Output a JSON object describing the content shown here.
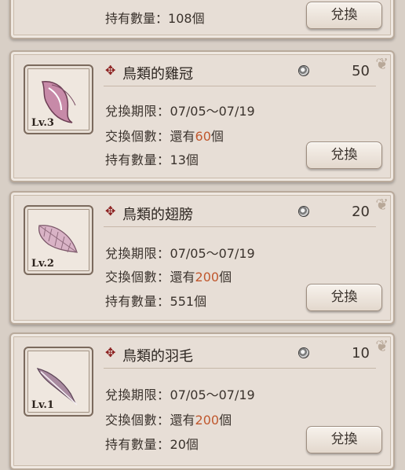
{
  "labels": {
    "exchange_period": "兌換期限：",
    "exchange_count": "交換個數：",
    "owned": "持有數量：",
    "remaining_prefix": "還有",
    "unit": "個",
    "exchange_button": "兌換"
  },
  "partial_item": {
    "owned_value": "108"
  },
  "items": [
    {
      "name": "鳥類的雞冠",
      "level": "Lv.3",
      "price": "50",
      "period": "07/05〜07/19",
      "remaining": "60",
      "owned": "13",
      "icon": "feather-crest-icon"
    },
    {
      "name": "鳥類的翅膀",
      "level": "Lv.2",
      "price": "20",
      "period": "07/05〜07/19",
      "remaining": "200",
      "owned": "551",
      "icon": "feather-wing-icon"
    },
    {
      "name": "鳥類的羽毛",
      "level": "Lv.1",
      "price": "10",
      "period": "07/05〜07/19",
      "remaining": "200",
      "owned": "20",
      "icon": "feather-icon"
    }
  ],
  "colors": {
    "accent_number": "#c0582e",
    "cross": "#8b1e1e"
  }
}
